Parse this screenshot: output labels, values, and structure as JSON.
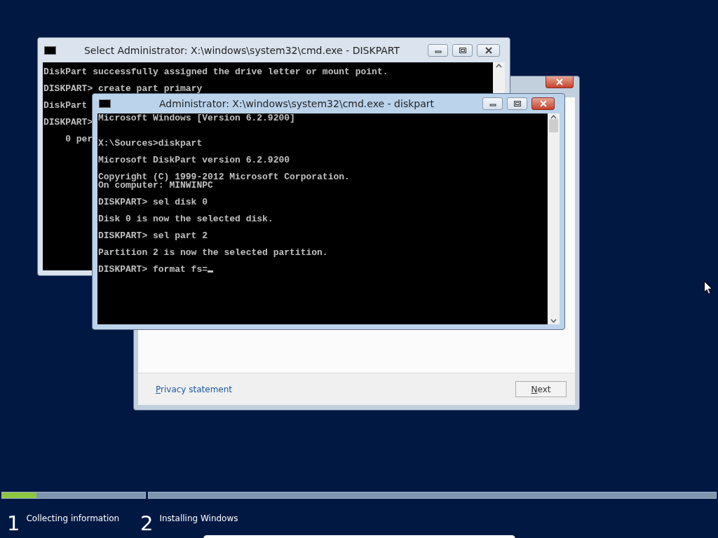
{
  "console_windows": [
    {
      "title": "Select Administrator: X:\\windows\\system32\\cmd.exe - DISKPART",
      "active": false,
      "output": "DiskPart successfully assigned the drive letter or mount point.\n\nDISKPART> create part primary\n\nDiskPart\n\nDISKPART>\n\n    0 per"
    },
    {
      "title": "Administrator: X:\\windows\\system32\\cmd.exe - diskpart",
      "active": true,
      "output": "Microsoft Windows [Version 6.2.9200]\n\n\nX:\\Sources>diskpart\n\nMicrosoft DiskPart version 6.2.9200\n\nCopyright (C) 1999-2012 Microsoft Corporation.\nOn computer: MINWINPC\n\nDISKPART> sel disk 0\n\nDisk 0 is now the selected disk.\n\nDISKPART> sel part 2\n\nPartition 2 is now the selected partition.\n\nDISKPART> format fs=",
      "cursor": true
    }
  ],
  "setup_window": {
    "link": {
      "label": "Privacy statement"
    },
    "next_button": {
      "label": "Next"
    }
  },
  "progress": {
    "steps": [
      {
        "number": "1",
        "label": "Collecting information",
        "level": 0.24
      },
      {
        "number": "2",
        "label": "Installing Windows",
        "level": 0
      }
    ]
  }
}
